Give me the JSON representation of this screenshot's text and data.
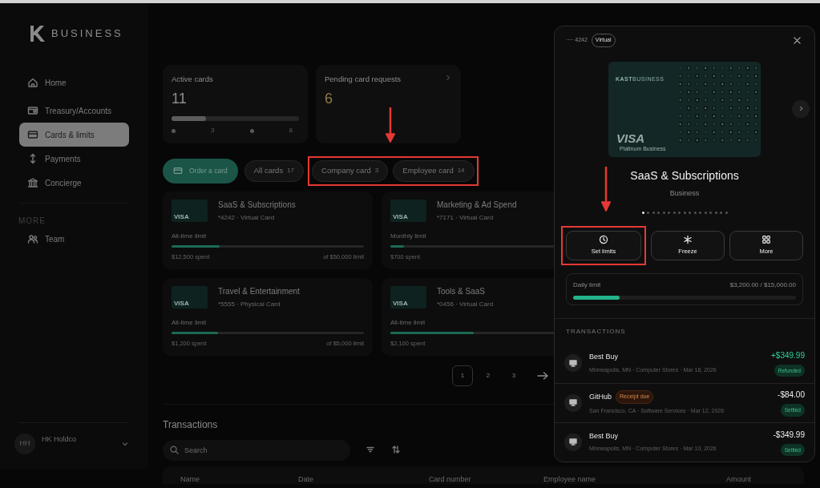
{
  "brand": {
    "name": "BUSINESS"
  },
  "nav": [
    {
      "label": "Home",
      "selected": false
    },
    {
      "label": "Treasury/Accounts",
      "selected": false
    },
    {
      "label": "Cards & limits",
      "selected": true
    },
    {
      "label": "Payments",
      "selected": false
    },
    {
      "label": "Concierge",
      "selected": false
    }
  ],
  "nav_more": {
    "heading": "MORE",
    "items": [
      {
        "label": "Team",
        "selected": false
      }
    ]
  },
  "account": {
    "initials": "HH",
    "name": "HK Holdco"
  },
  "stats": [
    {
      "kind": "progress",
      "title": "Active cards",
      "value": "11",
      "level": 0.27,
      "ticks": [
        {
          "kind": "dot"
        },
        {
          "kind": "label",
          "text": "3"
        },
        {
          "kind": "dot"
        },
        {
          "kind": "label",
          "text": "8"
        }
      ]
    },
    {
      "kind": "link",
      "title": "Pending card requests",
      "value": "6"
    }
  ],
  "order_button": "Order a card",
  "filter_groups": [
    {
      "callout": false,
      "items": [
        {
          "label": "All cards",
          "count": "17"
        }
      ]
    },
    {
      "callout": true,
      "items": [
        {
          "label": "Company card",
          "count": "3"
        },
        {
          "label": "Employee card",
          "count": "14"
        }
      ]
    }
  ],
  "cards": [
    {
      "name": "SaaS & Subscriptions",
      "meta": "*4242 · Virtual Card",
      "brand": "VISA",
      "limit_label": "All-time limit",
      "level": 0.25,
      "spent": "$12,500 spent",
      "limit": "of $50,000 limit"
    },
    {
      "name": "Marketing & Ad Spend",
      "meta": "*7171 · Virtual Card",
      "brand": "VISA",
      "limit_label": "Monthly limit",
      "level": 0.07,
      "spent": "$700 spent"
    },
    {
      "name": "Travel & Entertainment",
      "meta": "*5555 · Physical Card",
      "brand": "VISA",
      "limit_label": "All-time limit",
      "level": 0.24,
      "spent": "$1,200 spent",
      "limit": "of $5,000 limit"
    },
    {
      "name": "Tools & SaaS",
      "meta": "*0456 · Virtual Card",
      "brand": "VISA",
      "limit_label": "All-time limit",
      "level": 0.42,
      "spent": "$2,100 spent"
    }
  ],
  "pagination": [
    {
      "label": "1",
      "selected": true
    },
    {
      "label": "2",
      "selected": false
    },
    {
      "label": "3",
      "selected": false
    }
  ],
  "transactions_section": {
    "title": "Transactions",
    "search_placeholder": "Search",
    "columns": [
      "Name",
      "Date",
      "Card number",
      "Employee name",
      "Amount"
    ]
  },
  "panel": {
    "masked_number": "···· 4242",
    "badge": "Virtual",
    "card_art": {
      "brand_bold": "KAST",
      "brand_rest": "BUSINESS",
      "network": "VISA",
      "tier": "Platinum Business"
    },
    "title": "SaaS & Subscriptions",
    "subtitle": "Business",
    "slides": [
      {
        "selected": true
      },
      {
        "selected": false
      },
      {
        "selected": false
      },
      {
        "selected": false
      },
      {
        "selected": false
      },
      {
        "selected": false
      },
      {
        "selected": false
      },
      {
        "selected": false
      },
      {
        "selected": false
      },
      {
        "selected": false
      },
      {
        "selected": false
      },
      {
        "selected": false
      },
      {
        "selected": false
      },
      {
        "selected": false
      },
      {
        "selected": false
      },
      {
        "selected": false
      },
      {
        "selected": false
      }
    ],
    "actions": [
      {
        "label": "Set limits",
        "callout": true
      },
      {
        "label": "Freeze",
        "callout": false
      },
      {
        "label": "More",
        "callout": false
      }
    ],
    "daily_limit": {
      "label": "Daily limit",
      "amount": "$3,200.00 / $15,000.00",
      "level": 0.21
    },
    "transactions_heading": "TRANSACTIONS",
    "transactions": [
      {
        "merchant": "Best Buy",
        "details": "Minneapolis, MN · Computer Stores · Mar 18, 2026",
        "amount": "+$349.99",
        "kind": "credit",
        "status": "Refunded"
      },
      {
        "merchant": "GitHub",
        "tag": "Receipt due",
        "details": "San Francisco, CA · Software Services · Mar 12, 2026",
        "amount": "-$84.00",
        "kind": "debit",
        "status": "Settled"
      },
      {
        "merchant": "Best Buy",
        "details": "Minneapolis, MN · Computer Stores · Mar 10, 2026",
        "amount": "-$349.99",
        "kind": "debit",
        "status": "Settled"
      }
    ]
  }
}
